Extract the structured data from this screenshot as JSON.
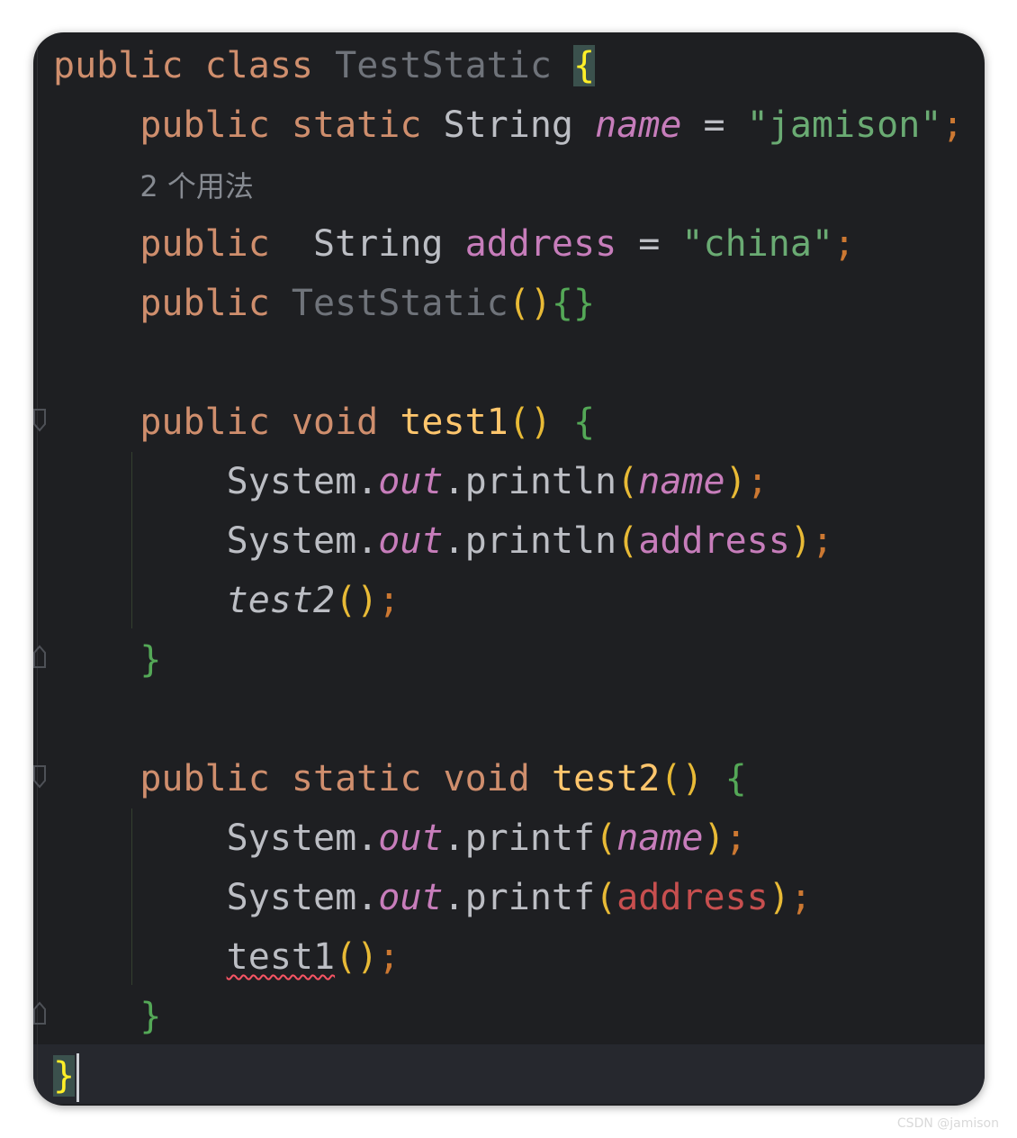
{
  "editor": {
    "lines": [
      {
        "tokens": [
          {
            "t": "public",
            "c": "kw"
          },
          {
            "t": " ",
            "c": "op"
          },
          {
            "t": "class",
            "c": "kw"
          },
          {
            "t": " ",
            "c": "op"
          },
          {
            "t": "TestStatic",
            "c": "cls-dim"
          },
          {
            "t": " ",
            "c": "op"
          },
          {
            "t": "{",
            "c": "brace-y brace-hl"
          }
        ]
      },
      {
        "indent": 1,
        "tokens": [
          {
            "t": "public",
            "c": "kw"
          },
          {
            "t": " ",
            "c": "op"
          },
          {
            "t": "static",
            "c": "kw"
          },
          {
            "t": " ",
            "c": "op"
          },
          {
            "t": "String",
            "c": "ty"
          },
          {
            "t": " ",
            "c": "op"
          },
          {
            "t": "name",
            "c": "fld-it"
          },
          {
            "t": " = ",
            "c": "op"
          },
          {
            "t": "\"jamison\"",
            "c": "str"
          },
          {
            "t": ";",
            "c": "semi"
          }
        ]
      },
      {
        "indent": 1,
        "hint": "2 个用法"
      },
      {
        "indent": 1,
        "tokens": [
          {
            "t": "public",
            "c": "kw"
          },
          {
            "t": "  ",
            "c": "op"
          },
          {
            "t": "String",
            "c": "ty"
          },
          {
            "t": " ",
            "c": "op"
          },
          {
            "t": "address",
            "c": "fld"
          },
          {
            "t": " = ",
            "c": "op"
          },
          {
            "t": "\"china\"",
            "c": "str"
          },
          {
            "t": ";",
            "c": "semi"
          }
        ]
      },
      {
        "indent": 1,
        "tokens": [
          {
            "t": "public",
            "c": "kw"
          },
          {
            "t": " ",
            "c": "op"
          },
          {
            "t": "TestStatic",
            "c": "cls-dim"
          },
          {
            "t": "()",
            "c": "paren"
          },
          {
            "t": "{}",
            "c": "brace-g"
          }
        ]
      },
      {
        "tokens": []
      },
      {
        "indent": 1,
        "tokens": [
          {
            "t": "public",
            "c": "kw"
          },
          {
            "t": " ",
            "c": "op"
          },
          {
            "t": "void",
            "c": "kw"
          },
          {
            "t": " ",
            "c": "op"
          },
          {
            "t": "test1",
            "c": "fn"
          },
          {
            "t": "()",
            "c": "paren"
          },
          {
            "t": " ",
            "c": "op"
          },
          {
            "t": "{",
            "c": "brace-g"
          }
        ]
      },
      {
        "indent": 2,
        "tokens": [
          {
            "t": "System.",
            "c": "ty"
          },
          {
            "t": "out",
            "c": "fld-it"
          },
          {
            "t": ".println",
            "c": "ty"
          },
          {
            "t": "(",
            "c": "paren"
          },
          {
            "t": "name",
            "c": "fld-it"
          },
          {
            "t": ")",
            "c": "paren"
          },
          {
            "t": ";",
            "c": "semi"
          }
        ]
      },
      {
        "indent": 2,
        "tokens": [
          {
            "t": "System.",
            "c": "ty"
          },
          {
            "t": "out",
            "c": "fld-it"
          },
          {
            "t": ".println",
            "c": "ty"
          },
          {
            "t": "(",
            "c": "paren"
          },
          {
            "t": "address",
            "c": "fld"
          },
          {
            "t": ")",
            "c": "paren"
          },
          {
            "t": ";",
            "c": "semi"
          }
        ]
      },
      {
        "indent": 2,
        "tokens": [
          {
            "t": "test2",
            "c": "static-call"
          },
          {
            "t": "()",
            "c": "paren"
          },
          {
            "t": ";",
            "c": "semi"
          }
        ]
      },
      {
        "indent": 1,
        "tokens": [
          {
            "t": "}",
            "c": "brace-g"
          }
        ]
      },
      {
        "tokens": []
      },
      {
        "indent": 1,
        "tokens": [
          {
            "t": "public",
            "c": "kw"
          },
          {
            "t": " ",
            "c": "op"
          },
          {
            "t": "static",
            "c": "kw"
          },
          {
            "t": " ",
            "c": "op"
          },
          {
            "t": "void",
            "c": "kw"
          },
          {
            "t": " ",
            "c": "op"
          },
          {
            "t": "test2",
            "c": "fn"
          },
          {
            "t": "()",
            "c": "paren"
          },
          {
            "t": " ",
            "c": "op"
          },
          {
            "t": "{",
            "c": "brace-g"
          }
        ]
      },
      {
        "indent": 2,
        "tokens": [
          {
            "t": "System.",
            "c": "ty"
          },
          {
            "t": "out",
            "c": "fld-it"
          },
          {
            "t": ".printf",
            "c": "ty"
          },
          {
            "t": "(",
            "c": "paren"
          },
          {
            "t": "name",
            "c": "fld-it"
          },
          {
            "t": ")",
            "c": "paren"
          },
          {
            "t": ";",
            "c": "semi"
          }
        ]
      },
      {
        "indent": 2,
        "tokens": [
          {
            "t": "System.",
            "c": "ty"
          },
          {
            "t": "out",
            "c": "fld-it"
          },
          {
            "t": ".printf",
            "c": "ty"
          },
          {
            "t": "(",
            "c": "paren"
          },
          {
            "t": "address",
            "c": "err"
          },
          {
            "t": ")",
            "c": "paren"
          },
          {
            "t": ";",
            "c": "semi"
          }
        ]
      },
      {
        "indent": 2,
        "tokens": [
          {
            "t": "test1",
            "c": "ty squiggle"
          },
          {
            "t": "()",
            "c": "paren"
          },
          {
            "t": ";",
            "c": "semi"
          }
        ]
      },
      {
        "indent": 1,
        "tokens": [
          {
            "t": "}",
            "c": "brace-g"
          }
        ]
      },
      {
        "tokens": [
          {
            "t": "}",
            "c": "brace-y brace-hl"
          }
        ],
        "caret": true
      }
    ]
  },
  "watermark": "CSDN @jamison",
  "colors": {
    "background": "#1e1f22",
    "keyword": "#cf8e6d",
    "string": "#6aab73",
    "field": "#c77dbb",
    "method_decl": "#ffc66d",
    "error": "#c74f4f"
  }
}
